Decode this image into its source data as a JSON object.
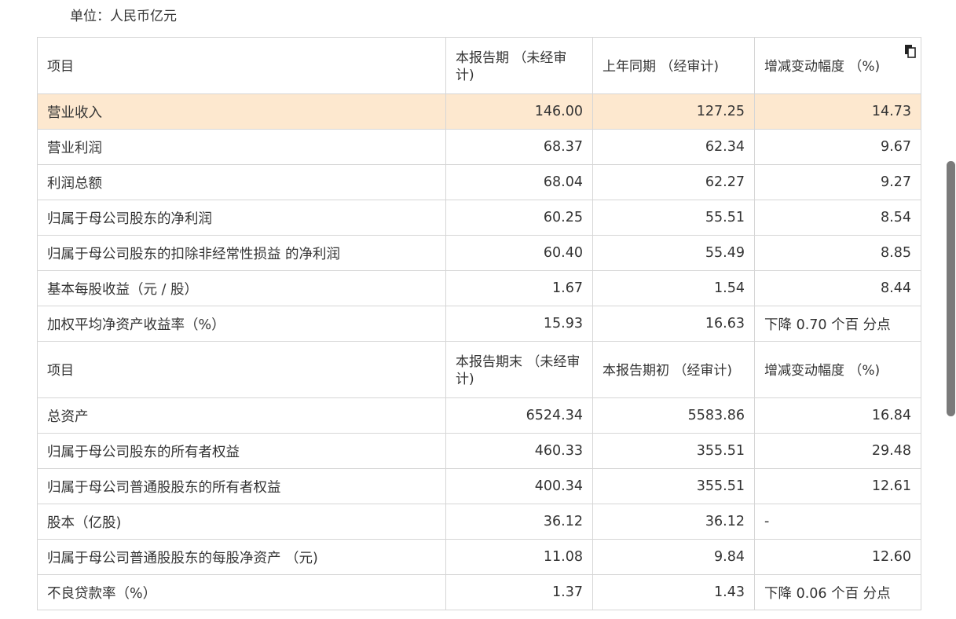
{
  "unit_label": "单位：人民币亿元",
  "table1": {
    "headers": [
      "项目",
      "本报告期 （未经审计)",
      "上年同期 （经审计)",
      "增减变动幅度 （%)"
    ],
    "rows": [
      [
        "营业收入",
        "146.00",
        "127.25",
        "14.73"
      ],
      [
        "营业利润",
        "68.37",
        "62.34",
        "9.67"
      ],
      [
        "利润总额",
        "68.04",
        "62.27",
        "9.27"
      ],
      [
        "归属于母公司股东的净利润",
        "60.25",
        "55.51",
        "8.54"
      ],
      [
        "归属于母公司股东的扣除非经常性损益 的净利润",
        "60.40",
        "55.49",
        "8.85"
      ],
      [
        "基本每股收益（元 / 股）",
        "1.67",
        "1.54",
        "8.44"
      ],
      [
        "加权平均净资产收益率（%）",
        "15.93",
        "16.63",
        "下降 0.70 个百 分点"
      ]
    ]
  },
  "table2": {
    "headers": [
      "项目",
      "本报告期末 （未经审计)",
      "本报告期初 （经审计)",
      "增减变动幅度 （%)"
    ],
    "rows": [
      [
        "总资产",
        "6524.34",
        "5583.86",
        "16.84"
      ],
      [
        "归属于母公司股东的所有者权益",
        "460.33",
        "355.51",
        "29.48"
      ],
      [
        "归属于母公司普通股股东的所有者权益",
        "400.34",
        "355.51",
        "12.61"
      ],
      [
        "股本（亿股)",
        "36.12",
        "36.12",
        "-"
      ],
      [
        "归属于母公司普通股股东的每股净资产 （元)",
        "11.08",
        "9.84",
        "12.60"
      ],
      [
        "不良贷款率（%）",
        "1.37",
        "1.43",
        "下降 0.06 个百 分点"
      ]
    ]
  },
  "colors": {
    "highlight": "#fde8cf",
    "border": "#d6d6d6",
    "scrollbar": "#7a7a7a"
  },
  "icons": {
    "copy": "copy-icon"
  }
}
